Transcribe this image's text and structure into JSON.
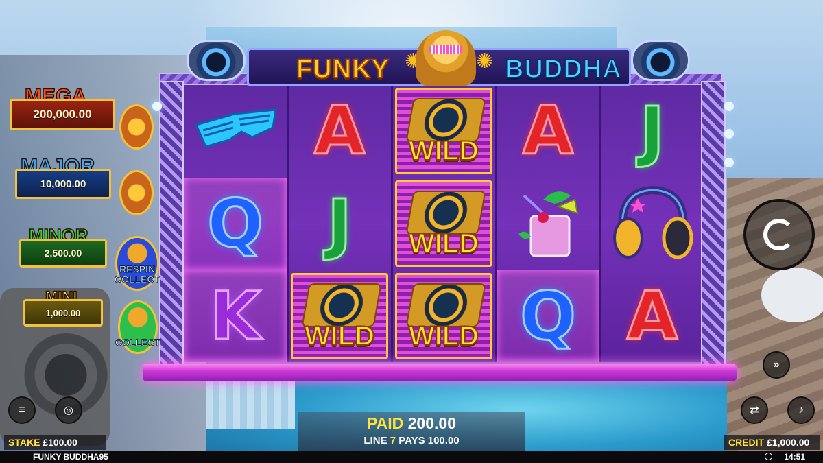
{
  "game": {
    "logo_left": "FUNKY",
    "logo_right": "BUDDHA",
    "status_title": "FUNKY BUDDHA95",
    "clock": "14:51"
  },
  "jackpots": [
    {
      "label": "MEGA",
      "value": "200,000.00",
      "color": "#ff3d1f"
    },
    {
      "label": "MAJOR",
      "value": "10,000.00",
      "color": "#3aa0ff"
    },
    {
      "label": "MINOR",
      "value": "2,500.00",
      "color": "#2edc3a"
    },
    {
      "label": "MINI",
      "value": "1,000.00",
      "color": "#ffe23b"
    }
  ],
  "jackpot_icons": [
    {
      "icon": "chained-buddha-icon",
      "text": ""
    },
    {
      "icon": "chained-buddha-icon",
      "text": ""
    },
    {
      "icon": "respin-collect-icon",
      "text": "RESPIN COLLECT"
    },
    {
      "icon": "collect-icon",
      "text": "COLLECT"
    }
  ],
  "reels": [
    [
      "shades",
      "Q",
      "K"
    ],
    [
      "A",
      "J",
      "WILD"
    ],
    [
      "WILD",
      "WILD",
      "WILD"
    ],
    [
      "A",
      "cocktail",
      "Q"
    ],
    [
      "J",
      "headphones",
      "A"
    ]
  ],
  "wild_label": "WILD",
  "win": {
    "paid_label": "PAID",
    "paid_value": "200.00",
    "line_label": "LINE",
    "line_number": "7",
    "pays_label": "PAYS",
    "pays_value": "100.00"
  },
  "stake": {
    "label": "STAKE",
    "value": "£100.00"
  },
  "credit": {
    "label": "CREDIT",
    "value": "£1,000.00"
  },
  "controls": {
    "menu_icon": "menu-icon",
    "coins_icon": "coins-icon",
    "spin_icon": "spin-arrow-icon",
    "turbo_icon": "fast-forward-icon",
    "autoplay_icon": "autoplay-icon",
    "sound_icon": "speaker-icon"
  }
}
